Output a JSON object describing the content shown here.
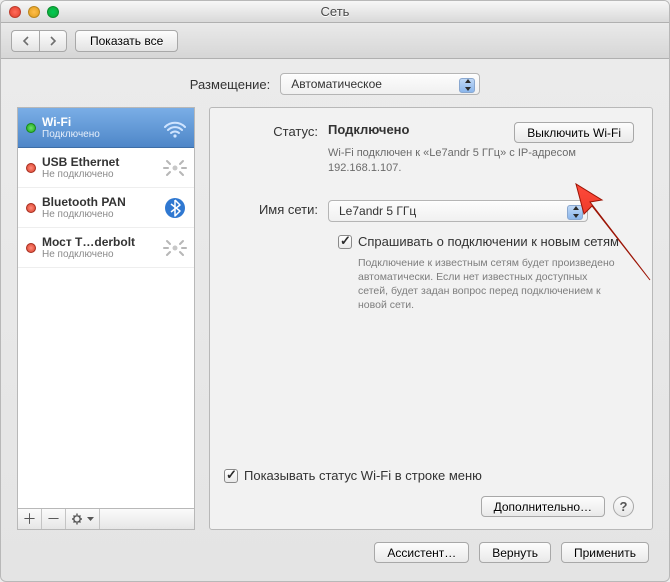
{
  "window": {
    "title": "Сеть"
  },
  "toolbar": {
    "show_all": "Показать все"
  },
  "location": {
    "label": "Размещение:",
    "value": "Автоматическое"
  },
  "sidebar": {
    "items": [
      {
        "title": "Wi-Fi",
        "sub": "Подключено"
      },
      {
        "title": "USB Ethernet",
        "sub": "Не подключено"
      },
      {
        "title": "Bluetooth PAN",
        "sub": "Не подключено"
      },
      {
        "title": "Мост T…derbolt",
        "sub": "Не подключено"
      }
    ]
  },
  "main": {
    "status_label": "Статус:",
    "status_value": "Подключено",
    "status_desc": "Wi-Fi подключен к «Le7andr 5 ГГц» с IP-адресом 192.168.1.107.",
    "wifi_off": "Выключить Wi-Fi",
    "network_label": "Имя сети:",
    "network_value": "Le7andr 5 ГГц",
    "ask_label": "Спрашивать о подключении к новым сетям",
    "ask_desc": "Подключение к известным сетям будет произведено автоматически. Если нет известных доступных сетей, будет задан вопрос перед подключением к новой сети.",
    "show_status_label": "Показывать статус Wi-Fi в строке меню",
    "advanced": "Дополнительно…"
  },
  "footer": {
    "assistant": "Ассистент…",
    "revert": "Вернуть",
    "apply": "Применить"
  }
}
